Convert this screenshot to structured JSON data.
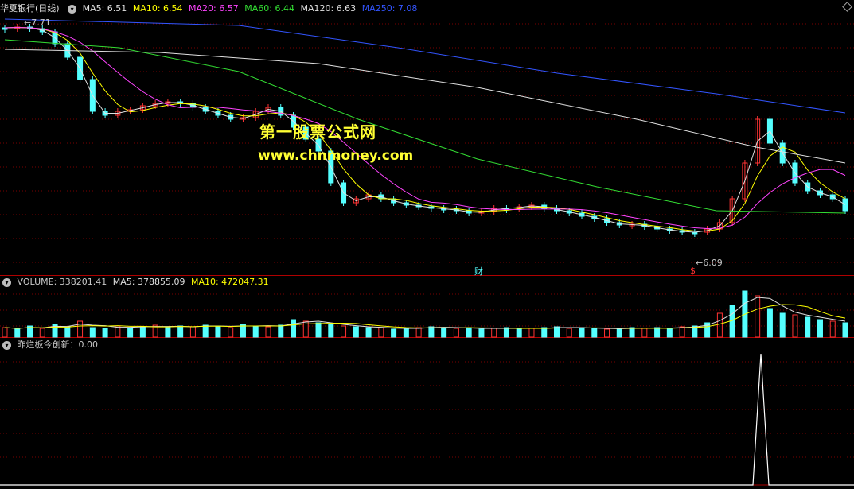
{
  "main_panel": {
    "title": "华夏银行(日线)",
    "indicators": [
      {
        "label": "MA5: 6.51",
        "color": "#e0e0e0"
      },
      {
        "label": "MA10: 6.54",
        "color": "#ffff00"
      },
      {
        "label": "MA20: 6.57",
        "color": "#ff44ff"
      },
      {
        "label": "MA60: 6.44",
        "color": "#33dd33"
      },
      {
        "label": "MA120: 6.63",
        "color": "#e0e0e0"
      },
      {
        "label": "MA250: 7.08",
        "color": "#3355ff"
      }
    ],
    "high_marker": "7.71",
    "low_marker": "6.09",
    "event_finance": "财",
    "event_dollar": "$"
  },
  "watermark": {
    "line1": "第一股票公式网",
    "line2": "www.chnmoney.com"
  },
  "volume_panel": {
    "indicators": [
      {
        "label": "VOLUME: 338201.41",
        "color": "#c8c8c8"
      },
      {
        "label": "MA5: 378855.09",
        "color": "#e0e0e0"
      },
      {
        "label": "MA10: 472047.31",
        "color": "#ffff00"
      }
    ]
  },
  "custom_panel": {
    "indicators": [
      {
        "label": "昨烂板今创新：0.00",
        "color": "#c8c8c8"
      }
    ]
  },
  "colors": {
    "up": "#ff3333",
    "down": "#54ffff",
    "grid": "#7a0000",
    "separator": "#b00000"
  },
  "icons": [
    "settings-circle-icon",
    "diamond-icon"
  ]
}
